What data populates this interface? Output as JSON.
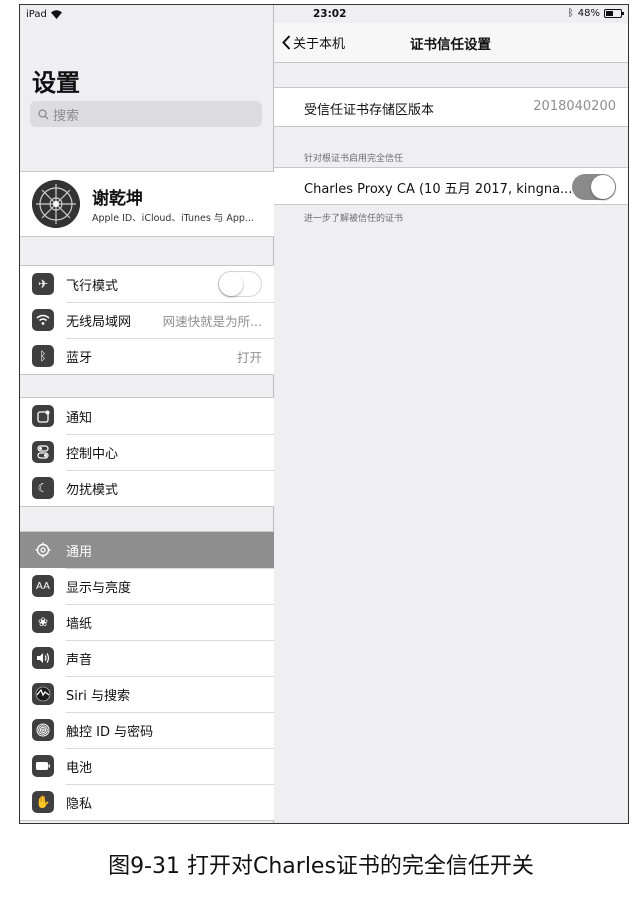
{
  "status_bar": {
    "device": "iPad",
    "time": "23:02",
    "battery": "48%",
    "battery_level": 0.48
  },
  "sidebar": {
    "title": "设置",
    "search_placeholder": "搜索",
    "profile": {
      "name": "谢乾坤",
      "subtitle": "Apple ID、iCloud、iTunes 与 App..."
    },
    "group1": [
      {
        "label": "飞行模式",
        "icon": "airplane-icon",
        "toggle": "off"
      },
      {
        "label": "无线局域网",
        "icon": "wifi-icon",
        "value": "网速快就是为所..."
      },
      {
        "label": "蓝牙",
        "icon": "bluetooth-icon",
        "value": "打开"
      }
    ],
    "group2": [
      {
        "label": "通知",
        "icon": "notification-icon"
      },
      {
        "label": "控制中心",
        "icon": "control-center-icon"
      },
      {
        "label": "勿扰模式",
        "icon": "moon-icon"
      }
    ],
    "group3": [
      {
        "label": "通用",
        "icon": "gear-icon",
        "selected": true
      },
      {
        "label": "显示与亮度",
        "icon": "display-aa-icon"
      },
      {
        "label": "墙纸",
        "icon": "wallpaper-icon"
      },
      {
        "label": "声音",
        "icon": "speaker-icon"
      },
      {
        "label": "Siri 与搜索",
        "icon": "siri-icon"
      },
      {
        "label": "触控 ID 与密码",
        "icon": "fingerprint-icon"
      },
      {
        "label": "电池",
        "icon": "battery-icon"
      },
      {
        "label": "隐私",
        "icon": "hand-icon"
      }
    ]
  },
  "detail": {
    "back_label": "关于本机",
    "title": "证书信任设置",
    "trust_store_label": "受信任证书存储区版本",
    "trust_store_value": "2018040200",
    "section_header": "针对根证书启用完全信任",
    "cert_label": "Charles Proxy CA (10 五月 2017, kingna...",
    "cert_toggle": "on",
    "footer_link": "进一步了解被信任的证书"
  },
  "caption": "图9-31 打开对Charles证书的完全信任开关",
  "colors": {
    "selected_row": "#8e8e8e",
    "toggle_on": "#8a8a8a",
    "icon_bg": "#3f3f3f"
  }
}
